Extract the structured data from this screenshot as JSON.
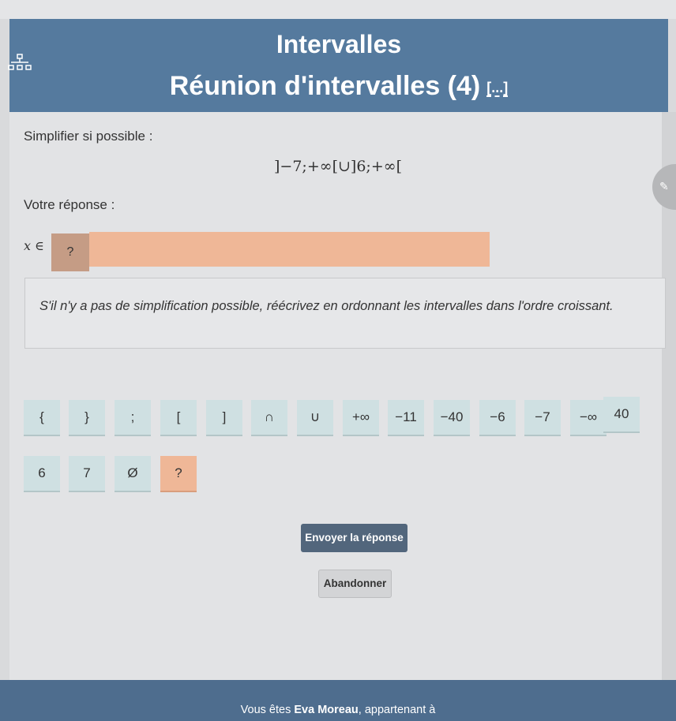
{
  "header": {
    "title": "Intervalles",
    "subtitle": "Réunion d'intervalles (4)",
    "more_link": "[...]",
    "icon": "tree-structure-icon"
  },
  "exercise": {
    "instruction": "Simplifier si possible :",
    "expression": "]−7;+∞[∪]6;+∞[",
    "response_label": "Votre réponse :",
    "prefix": "x ∈",
    "answer_marker": "?",
    "answer_value": "",
    "hint": "S'il n'y a pas de simplification possible, réécrivez en ordonnant les intervalles dans l'ordre croissant."
  },
  "keypad": {
    "row1": [
      "{",
      "}",
      ";",
      "[",
      "]",
      "∩",
      "∪",
      "+∞",
      "−11",
      "−40",
      "−6",
      "−7",
      "−∞",
      "40"
    ],
    "row2": [
      "6",
      "7",
      "Ø",
      "?"
    ]
  },
  "buttons": {
    "send": "Envoyer la réponse",
    "abandon": "Abandonner"
  },
  "footer": {
    "prefix": "Vous êtes ",
    "user": "Eva Moreau",
    "suffix": ", appartenant à"
  },
  "colors": {
    "header_bg": "#557a9e",
    "key_bg": "#cfe0e2",
    "answer_bg": "#efb797",
    "send_button": "#52667c"
  }
}
